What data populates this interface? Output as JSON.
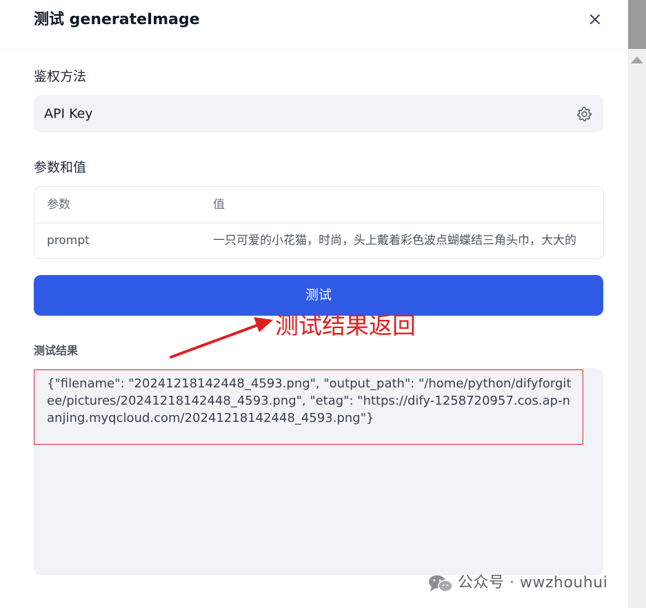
{
  "dialog": {
    "title": "测试 generateImage",
    "close_icon": "close-icon"
  },
  "auth": {
    "label": "鉴权方法",
    "value": "API Key",
    "settings_icon": "gear-icon"
  },
  "params": {
    "label": "参数和值",
    "columns": [
      "参数",
      "值"
    ],
    "rows": [
      {
        "name": "prompt",
        "value": "一只可爱的小花猫，时尚，头上戴着彩色波点蝴蝶结三角头巾，大大的"
      }
    ]
  },
  "test_button": {
    "label": "测试"
  },
  "annotation": {
    "text": "测试结果返回",
    "color": "#e21f1f"
  },
  "result": {
    "label": "测试结果",
    "text": "{\"filename\": \"20241218142448_4593.png\", \"output_path\": \"/home/python/difyforgitee/pictures/20241218142448_4593.png\", \"etag\": \"https://dify-1258720957.cos.ap-nanjing.myqcloud.com/20241218142448_4593.png\"}"
  },
  "watermark": {
    "text": "公众号 · wwzhouhui",
    "icon": "wechat-icon"
  },
  "colors": {
    "primary": "#2f5be7",
    "panel_bg": "#f2f3f6"
  }
}
